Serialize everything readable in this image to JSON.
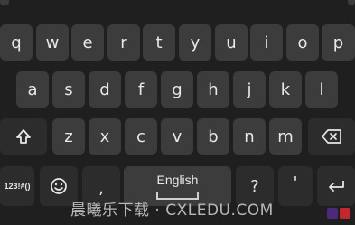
{
  "keyboard": {
    "row1": [
      "q",
      "w",
      "e",
      "r",
      "t",
      "y",
      "u",
      "i",
      "o",
      "p"
    ],
    "row2": [
      "a",
      "s",
      "d",
      "f",
      "g",
      "h",
      "j",
      "k",
      "l"
    ],
    "row3": [
      "z",
      "x",
      "c",
      "v",
      "b",
      "n",
      "m"
    ],
    "bottom": {
      "symbols_label": "123!#()",
      "comma_label": ",",
      "space_label": "English",
      "question_label": "?",
      "apostrophe_label": "'"
    }
  },
  "watermark": {
    "text": "晨曦乐下载 · CXLEDU.COM"
  },
  "icons": {
    "shift": "shift-arrow-icon",
    "backspace": "backspace-icon",
    "emoji": "emoji-icon",
    "enter": "enter-icon"
  },
  "colors": {
    "background": "#1f1f1f",
    "key": "#3c3c3c",
    "text": "#e8e8e8"
  }
}
